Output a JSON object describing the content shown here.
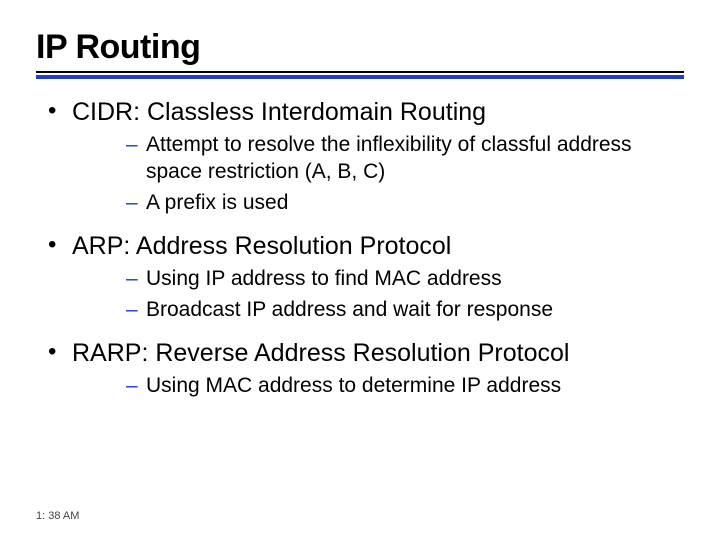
{
  "title": "IP Routing",
  "bullets": [
    {
      "text": "CIDR: Classless Interdomain Routing",
      "sub": [
        "Attempt to resolve the inflexibility of classful address space restriction (A, B, C)",
        "A prefix is used"
      ]
    },
    {
      "text": "ARP: Address Resolution Protocol",
      "sub": [
        "Using IP address to find MAC address",
        "Broadcast IP address and wait for response"
      ]
    },
    {
      "text": "RARP: Reverse Address Resolution Protocol",
      "sub": [
        "Using MAC address to determine IP address"
      ]
    }
  ],
  "timestamp": "1: 38 AM"
}
